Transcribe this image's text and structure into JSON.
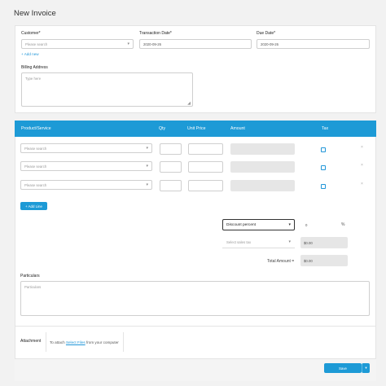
{
  "page": {
    "title": "New Invoice"
  },
  "customer": {
    "label": "Customer*",
    "placeholder": "Please search",
    "add_new": "+ Add new"
  },
  "transaction_date": {
    "label": "Transaction Date*",
    "value": "2020-09-26"
  },
  "due_date": {
    "label": "Due Date*",
    "value": "2020-09-26"
  },
  "billing": {
    "label": "Billing Address",
    "placeholder": "Type here"
  },
  "table": {
    "headers": {
      "product": "Product/Service",
      "qty": "Qty",
      "unit_price": "Unit Price",
      "amount": "Amount",
      "tax": "Tax"
    },
    "rows": [
      {
        "product_placeholder": "Please search"
      },
      {
        "product_placeholder": "Please search"
      },
      {
        "product_placeholder": "Please search"
      }
    ],
    "remove_symbol": "×",
    "add_line": "+ Add Line"
  },
  "totals": {
    "discount_select": "Discount percent",
    "discount_value": "0",
    "percent_symbol": "%",
    "discount_amount": "$0.00",
    "tax_select_placeholder": "Select sales tax",
    "tax_amount": "$0.00",
    "total_label": "Total Amount =",
    "total_value": "$0.00"
  },
  "particulars": {
    "label": "Particulars",
    "placeholder": "Particulars"
  },
  "attachment": {
    "label": "Attachment",
    "prefix": "To attach",
    "link": "Select Files",
    "suffix": "from your computer"
  },
  "footer": {
    "save": "Save",
    "caret": "▾"
  },
  "colors": {
    "accent": "#1d9ad6",
    "background": "#f2f2f2"
  }
}
